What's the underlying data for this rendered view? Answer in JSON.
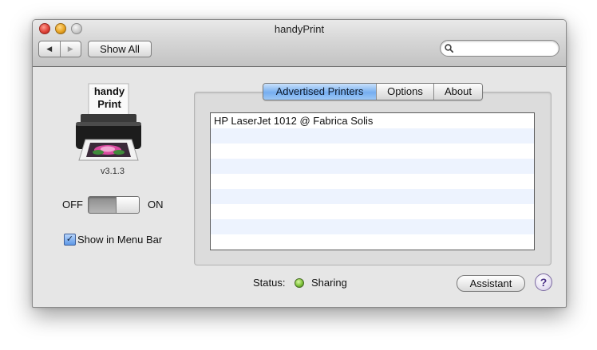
{
  "window": {
    "title": "handyPrint"
  },
  "toolbar": {
    "back_icon": "back-arrow-icon",
    "forward_icon": "forward-arrow-icon",
    "show_all_label": "Show All",
    "search": {
      "value": "",
      "placeholder": ""
    }
  },
  "app": {
    "logo": {
      "line1": "handy",
      "line2": "Print"
    },
    "version": "v3.1.3",
    "switch": {
      "off_label": "OFF",
      "on_label": "ON",
      "state": "on"
    },
    "menu_bar_checkbox": {
      "label": "Show in Menu Bar",
      "checked": true
    }
  },
  "tabs": [
    {
      "label": "Advertised Printers",
      "active": true
    },
    {
      "label": "Options",
      "active": false
    },
    {
      "label": "About",
      "active": false
    }
  ],
  "printers": [
    {
      "name": "HP LaserJet 1012 @ Fabrica Solis"
    }
  ],
  "status": {
    "label": "Status:",
    "value": "Sharing",
    "indicator_color": "#7fc33a"
  },
  "assistant_label": "Assistant",
  "help_label": "?"
}
